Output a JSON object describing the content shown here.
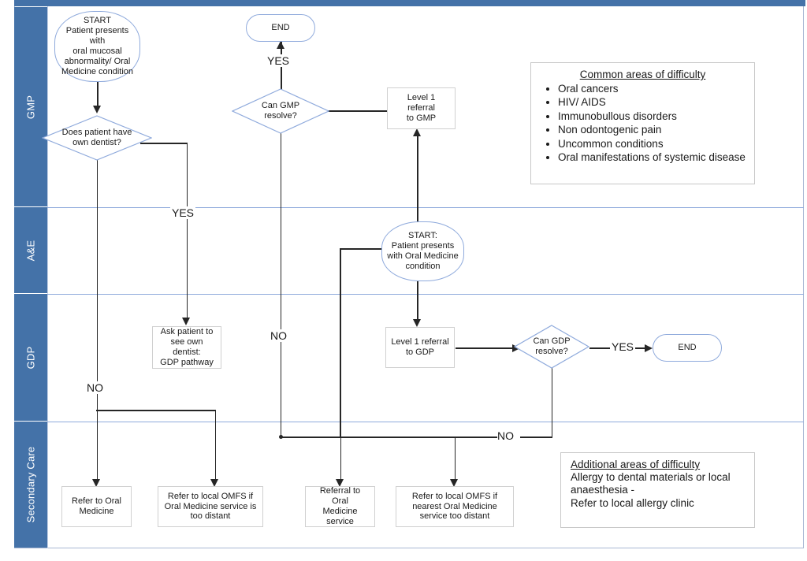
{
  "diagram": {
    "title": "Oral Medicine referral pathway swimlane flowchart",
    "accent_color": "#4472a8",
    "lane_divider_color": "#8faadc",
    "connector_color": "#262626"
  },
  "lanes": [
    {
      "id": "gmp",
      "label": "GMP"
    },
    {
      "id": "ae",
      "label": "A&E"
    },
    {
      "id": "gdp",
      "label": "GDP"
    },
    {
      "id": "secondary",
      "label": "Secondary Care"
    }
  ],
  "nodes": {
    "start_gmp": "START\nPatient presents with oral mucosal abnormality/ Oral Medicine condition",
    "end_top": "END",
    "decision_gmp": "Can GMP resolve?",
    "level1_gmp": "Level 1 referral to GMP",
    "decision_dentist": "Does patient have own dentist?",
    "start_ae": "START:\nPatient presents with Oral Medicine condition",
    "ask_patient": "Ask patient to see own dentist: GDP pathway",
    "level1_gdp": "Level 1 referral to GDP",
    "decision_gdp": "Can GDP resolve?",
    "end_gdp": "END",
    "refer_oral_medicine": "Refer to Oral Medicine",
    "refer_omfs_distant": "Refer to local OMFS if Oral Medicine service is too distant",
    "referral_oral_medicine_service": "Referral to Oral Medicine service",
    "refer_omfs_nearest": "Refer to local OMFS if nearest Oral Medicine service too distant"
  },
  "node_lines": {
    "start_gmp": [
      "START",
      "Patient presents with",
      "oral mucosal",
      "abnormality/ Oral",
      "Medicine condition"
    ],
    "decision_gmp": [
      "Can GMP",
      "resolve?"
    ],
    "level1_gmp": [
      "Level 1 referral",
      "to GMP"
    ],
    "decision_dentist": [
      "Does patient have",
      "own dentist?"
    ],
    "start_ae": [
      "START:",
      "Patient presents",
      "with Oral Medicine",
      "condition"
    ],
    "ask_patient": [
      "Ask patient to",
      "see own dentist:",
      "GDP pathway"
    ],
    "level1_gdp": [
      "Level 1 referral",
      "to GDP"
    ],
    "decision_gdp": [
      "Can GDP",
      "resolve?"
    ],
    "refer_oral_medicine": [
      "Refer to Oral",
      "Medicine"
    ],
    "refer_omfs_distant": [
      "Refer to local OMFS if",
      "Oral Medicine service is",
      "too distant"
    ],
    "referral_oral_medicine_service": [
      "Referral to Oral",
      "Medicine service"
    ],
    "refer_omfs_nearest": [
      "Refer to local OMFS if",
      "nearest Oral Medicine",
      "service too distant"
    ]
  },
  "edge_labels": {
    "gmp_resolve_yes": "YES",
    "dentist_yes": "YES",
    "dentist_no": "NO",
    "gmp_resolve_no": "NO",
    "gdp_resolve_yes": "YES",
    "gdp_resolve_no": "NO"
  },
  "notes": {
    "common": {
      "title": "Common areas of difficulty",
      "items": [
        "Oral cancers",
        "HIV/ AIDS",
        "Immunobullous disorders",
        "Non odontogenic pain",
        "Uncommon conditions",
        "Oral manifestations of systemic disease"
      ]
    },
    "additional": {
      "title": "Additional areas of difficulty",
      "lines": [
        "Allergy to dental materials or local",
        "anaesthesia -",
        "Refer to local allergy clinic"
      ]
    }
  }
}
